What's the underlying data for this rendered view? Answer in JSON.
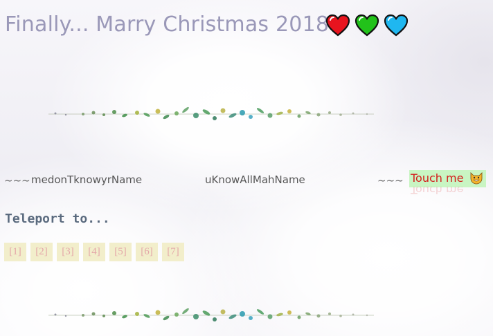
{
  "title": "Finally... Marry Christmas 2018",
  "hearts": [
    {
      "icon": "red-heart-icon",
      "color": "#e8141e"
    },
    {
      "icon": "green-heart-icon",
      "color": "#22c21a"
    },
    {
      "icon": "blue-heart-icon",
      "color": "#1fb7f0"
    }
  ],
  "names_row": {
    "tilde_left": "~~~",
    "name_left": "medonTknowyrName",
    "name_center": "uKnowAllMahName",
    "tilde_right": "~~~",
    "touch_label": "Touch me",
    "touch_icon": "grinning-cat-icon"
  },
  "teleport": {
    "heading": "Teleport to...",
    "buttons": [
      "[1]",
      "[2]",
      "[3]",
      "[4]",
      "[5]",
      "[6]",
      "[7]"
    ]
  },
  "colors": {
    "title": "#9a98b8",
    "touch_bg": "#c9f5c3",
    "touch_text": "#d41b1b",
    "teleport_btn_bg": "#f2eecb",
    "teleport_btn_text": "#e4a6a8"
  }
}
